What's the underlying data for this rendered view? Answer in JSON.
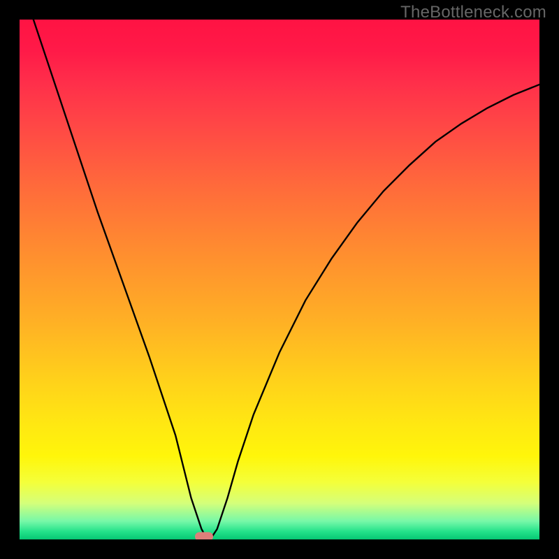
{
  "watermark": "TheBottleneck.com",
  "colors": {
    "frame": "#000000",
    "curve": "#000000",
    "marker": "#de7f7a",
    "watermark": "#666666"
  },
  "chart_data": {
    "type": "line",
    "title": "",
    "xlabel": "",
    "ylabel": "",
    "xlim": [
      0,
      100
    ],
    "ylim": [
      0,
      100
    ],
    "series": [
      {
        "name": "bottleneck-curve",
        "x": [
          0,
          5,
          10,
          15,
          20,
          25,
          30,
          33,
          35,
          36,
          37,
          38,
          40,
          42,
          45,
          50,
          55,
          60,
          65,
          70,
          75,
          80,
          85,
          90,
          95,
          100
        ],
        "values": [
          108,
          93,
          78,
          63,
          49,
          35,
          20,
          8,
          2,
          0.2,
          0.5,
          2,
          8,
          15,
          24,
          36,
          46,
          54,
          61,
          67,
          72,
          76.5,
          80,
          83,
          85.5,
          87.5
        ]
      }
    ],
    "marker": {
      "x": 35.5,
      "y": 0.6
    },
    "gradient_stops": [
      {
        "pos": 0.0,
        "color": "#ff1343"
      },
      {
        "pos": 0.2,
        "color": "#ff4646"
      },
      {
        "pos": 0.45,
        "color": "#ff8e2f"
      },
      {
        "pos": 0.7,
        "color": "#ffd31a"
      },
      {
        "pos": 0.84,
        "color": "#fff60a"
      },
      {
        "pos": 0.93,
        "color": "#d5ff7a"
      },
      {
        "pos": 0.985,
        "color": "#23e28a"
      },
      {
        "pos": 1.0,
        "color": "#06c774"
      }
    ]
  }
}
